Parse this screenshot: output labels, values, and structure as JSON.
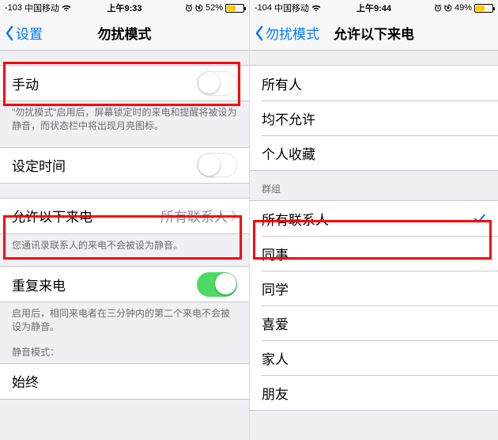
{
  "left": {
    "status": {
      "signal": "-103",
      "carrier": "中国移动",
      "time": "上午9:33",
      "battery_pct": "52%",
      "battery_fill": 52
    },
    "nav": {
      "back": "设置",
      "title": "勿扰模式"
    },
    "rows": {
      "manual": "手动",
      "manual_footer": "\"勿扰模式\"启用后，屏幕锁定时的来电和提醒将被设为静音，而状态栏中将出现月亮图标。",
      "schedule": "设定时间",
      "allow_from": "允许以下来电",
      "allow_from_value": "所有联系人",
      "allow_from_footer": "您通讯录联系人的来电不会被设为静音。",
      "repeat": "重复来电",
      "repeat_footer": "启用后，相同来电者在三分钟内的第二个来电不会被设为静音。",
      "silence_header": "静音模式：",
      "always": "始终"
    }
  },
  "right": {
    "status": {
      "signal": "-104",
      "carrier": "中国移动",
      "time": "上午9:44",
      "battery_pct": "49%",
      "battery_fill": 49
    },
    "nav": {
      "back": "勿扰模式",
      "title": "允许以下来电"
    },
    "section1": [
      "所有人",
      "均不允许",
      "个人收藏"
    ],
    "groups_header": "群组",
    "groups": [
      "所有联系人",
      "同事",
      "同学",
      "喜爱",
      "家人",
      "朋友"
    ],
    "checked_index": 0
  },
  "colors": {
    "accent": "#007aff",
    "switch_on": "#4cd964",
    "highlight": "#ff0000"
  }
}
